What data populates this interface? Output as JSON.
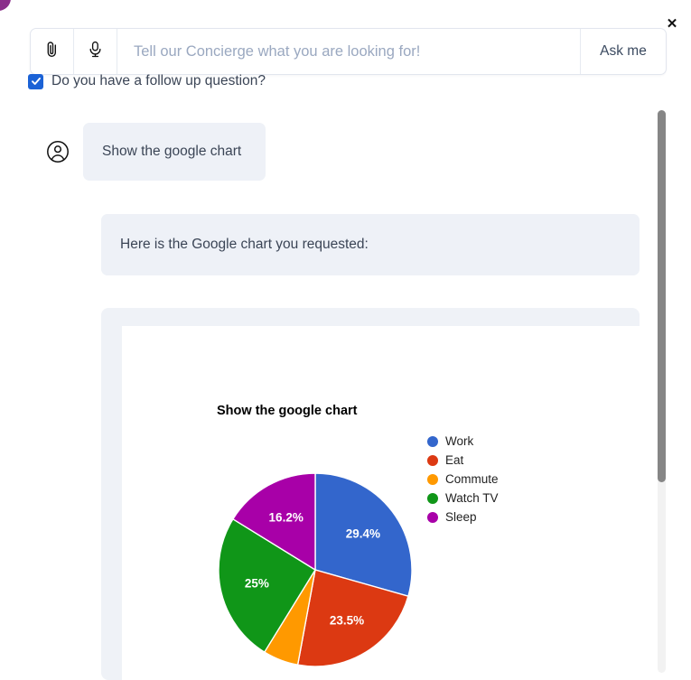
{
  "window": {
    "close_label": "✕"
  },
  "composer": {
    "attach_icon": "paperclip-icon",
    "mic_icon": "microphone-icon",
    "input_value": "",
    "placeholder": "Tell our Concierge what you are looking for!",
    "submit_label": "Ask me"
  },
  "followup": {
    "checked": true,
    "label": "Do you have a follow up question?"
  },
  "conversation": {
    "user_avatar_icon": "user-circle-icon",
    "messages": [
      {
        "role": "user",
        "text": "Show the google chart"
      },
      {
        "role": "assistant",
        "text": "Here is the Google chart you requested:"
      }
    ]
  },
  "chart_data": {
    "type": "pie",
    "title": "Show the google chart",
    "xlabel": "",
    "ylabel": "",
    "legend_position": "right",
    "categories": [
      "Work",
      "Eat",
      "Commute",
      "Watch TV",
      "Sleep"
    ],
    "values": [
      29.4,
      23.5,
      5.9,
      25,
      16.2
    ],
    "value_labels": [
      "29.4%",
      "23.5%",
      "",
      "25%",
      "16.2%"
    ],
    "colors": [
      "#3366cc",
      "#dc3912",
      "#ff9900",
      "#109618",
      "#a800a8"
    ],
    "slices": [
      {
        "name": "Work",
        "percent": 29.4,
        "label": "29.4%",
        "color": "#3366cc"
      },
      {
        "name": "Eat",
        "percent": 23.5,
        "label": "23.5%",
        "color": "#dc3912"
      },
      {
        "name": "Commute",
        "percent": 5.9,
        "label": "",
        "color": "#ff9900"
      },
      {
        "name": "Watch TV",
        "percent": 25,
        "label": "25%",
        "color": "#109618"
      },
      {
        "name": "Sleep",
        "percent": 16.2,
        "label": "16.2%",
        "color": "#a800a8"
      }
    ]
  },
  "scrollbar": {
    "thumb_color": "#868686",
    "track_color": "#f2f2f2"
  }
}
